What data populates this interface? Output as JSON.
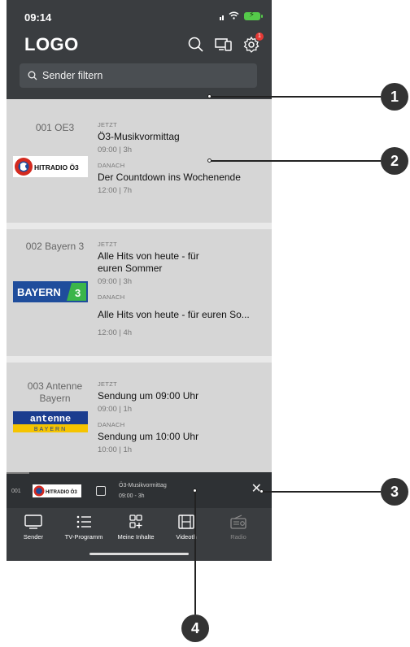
{
  "status": {
    "time": "09:14"
  },
  "header": {
    "logo": "LOGO",
    "settings_badge": "1"
  },
  "search": {
    "placeholder": "Sender filtern"
  },
  "channels": [
    {
      "name": "001 OE3",
      "logo_text": "HITRADIO Ö3",
      "now_label": "JETZT",
      "now_title": "Ö3-Musikvormittag",
      "now_time": "09:00 | 3h",
      "next_label": "DANACH",
      "next_title": "Der Countdown ins Wochenende",
      "next_time": "12:00 | 7h"
    },
    {
      "name": "002 Bayern 3",
      "logo_text": "BAYERN",
      "logo_badge": "3",
      "now_label": "JETZT",
      "now_title": "Alle Hits von heute - für euren Sommer",
      "now_time": "09:00 | 3h",
      "next_label": "DANACH",
      "next_title": "Alle Hits von heute - für euren So...",
      "next_time": "12:00 | 4h"
    },
    {
      "name": "003 Antenne Bayern",
      "logo_text": "antenne",
      "logo_sub": "BAYERN",
      "now_label": "JETZT",
      "now_title": "Sendung um 09:00 Uhr",
      "now_time": "09:00 | 1h",
      "next_label": "DANACH",
      "next_title": "Sendung um 10:00 Uhr",
      "next_time": "10:00 | 1h"
    }
  ],
  "mini_player": {
    "channel_no": "001",
    "logo_text": "HITRADIO Ö3",
    "title": "Ö3-Musikvormittag",
    "time": "09:00 - 3h"
  },
  "nav": [
    {
      "label": "Sender",
      "icon": "tv-icon"
    },
    {
      "label": "TV-Programm",
      "icon": "list-icon"
    },
    {
      "label": "Meine Inhalte",
      "icon": "grid-plus-icon"
    },
    {
      "label": "Videoth",
      "icon": "film-icon"
    },
    {
      "label": "Radio",
      "icon": "radio-icon"
    }
  ],
  "callouts": [
    "1",
    "2",
    "3",
    "4"
  ],
  "colors": {
    "header_bg": "#3a3d40",
    "card_bg": "#d6d6d6",
    "badge": "#e53935",
    "battery": "#55c94a",
    "oe3_red": "#d42a1f",
    "bayern_blue": "#1f4d9c",
    "antenne_blue": "#1b3d8f"
  }
}
